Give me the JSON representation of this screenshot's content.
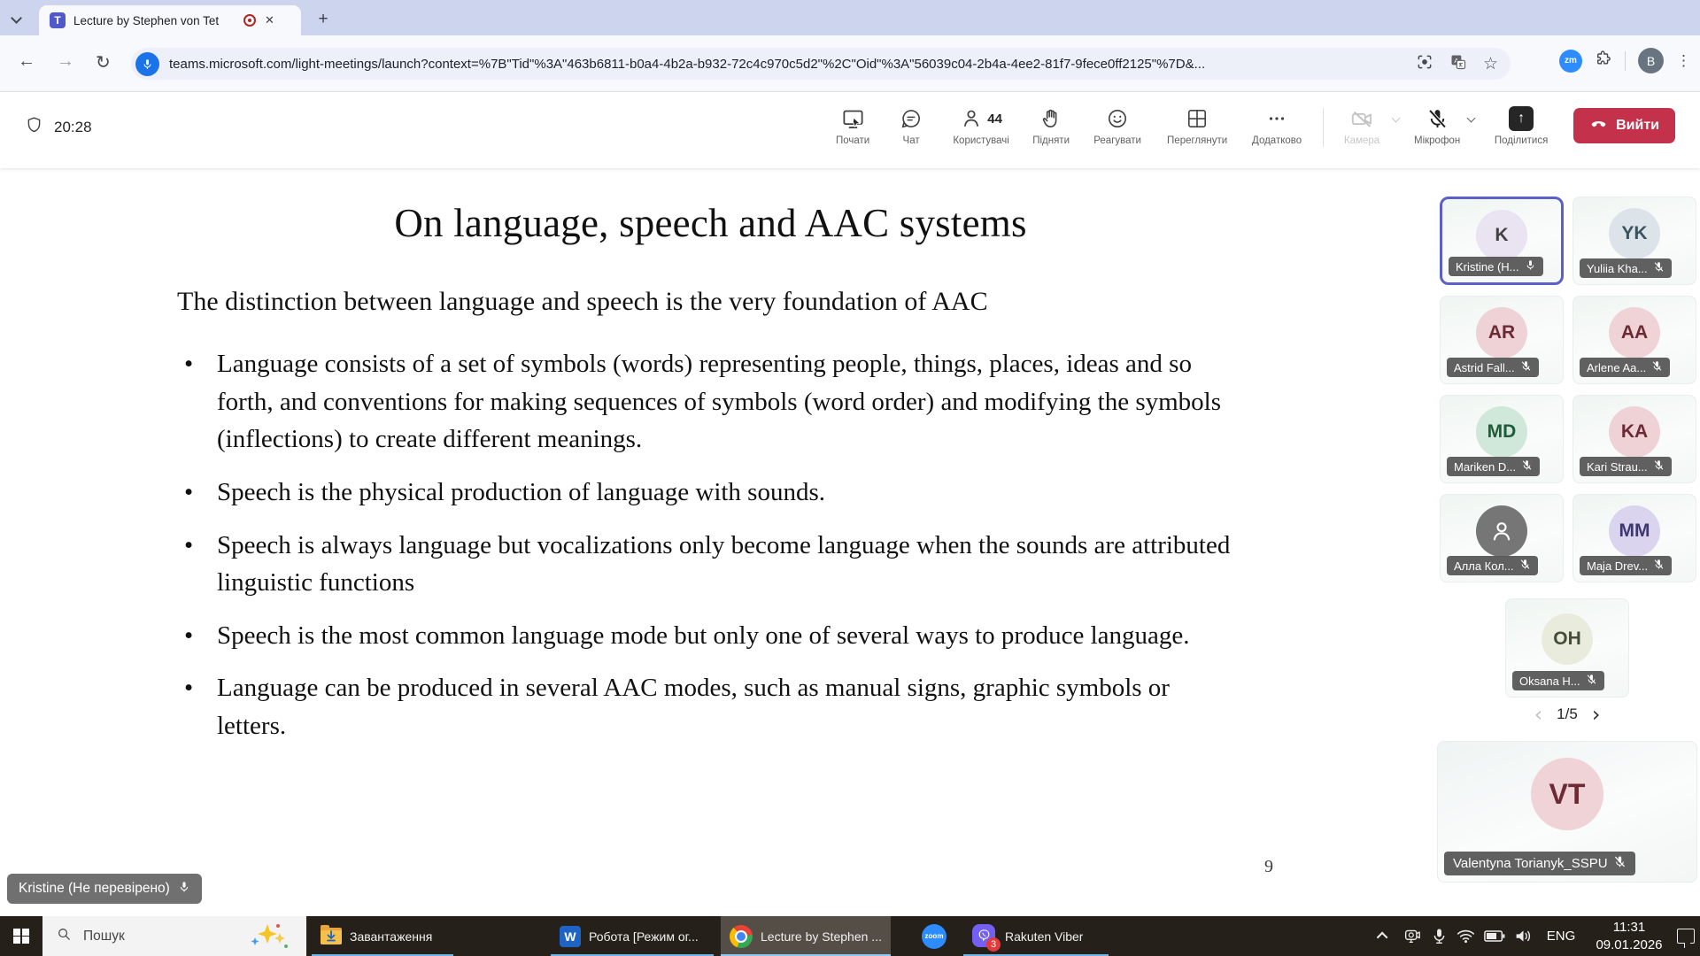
{
  "browser": {
    "tab_title": "Lecture by Stephen von Tet",
    "new_tab_label": "+",
    "url": "teams.microsoft.com/light-meetings/launch?context=%7B\"Tid\"%3A\"463b6811-b0a4-4b2a-b932-72c4c970c5d2\"%2C\"Oid\"%3A\"56039c04-2b4a-4ee2-81f7-9fece0ff2125\"%7D&...",
    "zoom_extension_label": "zm",
    "profile_initial": "B",
    "close_glyph": "✕",
    "back_glyph": "←",
    "forward_glyph": "→",
    "reload_glyph": "↻",
    "star_glyph": "☆",
    "kebab_glyph": "⋮"
  },
  "meeting": {
    "timer": "20:28",
    "controls": [
      {
        "label": "Почати"
      },
      {
        "label": "Чат"
      },
      {
        "label": "Користувачі",
        "count": "44"
      },
      {
        "label": "Підняти"
      },
      {
        "label": "Реагувати"
      },
      {
        "label": "Переглянути"
      },
      {
        "label": "Додатково"
      },
      {
        "label": "Камера",
        "disabled": true
      },
      {
        "label": "Мікрофон",
        "muted": true
      },
      {
        "label": "Поділитися",
        "share_glyph": "↑"
      }
    ],
    "leave_label": "Вийти"
  },
  "slide": {
    "title": "On language, speech and AAC systems",
    "intro": "The distinction between language and speech is the very foundation of AAC",
    "bullets": [
      "Language consists of a set of symbols (words) representing people, things, places, ideas and so forth, and conventions for making sequences of symbols (word order) and modifying the symbols (inflections) to create different meanings.",
      "Speech is the physical production of language with sounds.",
      "Speech is always language but vocalizations only become language when the sounds are attributed linguistic functions",
      "Speech is the most common language mode but only one of several ways to produce language.",
      "Language can be produced in several AAC modes, such as manual signs, graphic symbols or letters."
    ],
    "page_number": "9"
  },
  "presenter_badge": {
    "name": "Kristine (Не перевірено)",
    "muted": false
  },
  "participants": {
    "tiles": [
      {
        "initials": "K",
        "name": "Kristine (H...",
        "muted": false,
        "active": true,
        "avatar_bg": "#eae3f2",
        "avatar_fg": "#424242"
      },
      {
        "initials": "YK",
        "name": "Yuliia Kha...",
        "muted": true,
        "active": false,
        "avatar_bg": "#dde4e9",
        "avatar_fg": "#39545e"
      },
      {
        "initials": "AR",
        "name": "Astrid Fall...",
        "muted": true,
        "active": false,
        "avatar_bg": "#eed2d6",
        "avatar_fg": "#6b2a34"
      },
      {
        "initials": "AA",
        "name": "Arlene Aa...",
        "muted": true,
        "active": false,
        "avatar_bg": "#f0d3d7",
        "avatar_fg": "#6b2a34"
      },
      {
        "initials": "MD",
        "name": "Mariken D...",
        "muted": true,
        "active": false,
        "avatar_bg": "#d0e8da",
        "avatar_fg": "#1e5c3a"
      },
      {
        "initials": "KA",
        "name": "Kari Strau...",
        "muted": true,
        "active": false,
        "avatar_bg": "#eed2d6",
        "avatar_fg": "#6b2a34"
      },
      {
        "initials": "",
        "name": "Алла Кол...",
        "muted": true,
        "active": false,
        "avatar_bg": "#767676",
        "avatar_fg": "#ffffff"
      },
      {
        "initials": "MM",
        "name": "Maja Drev...",
        "muted": true,
        "active": false,
        "avatar_bg": "#dad4ee",
        "avatar_fg": "#3d3870"
      },
      {
        "initials": "OH",
        "name": "Oksana H...",
        "muted": true,
        "active": false,
        "avatar_bg": "#e9ecdd",
        "avatar_fg": "#454d39"
      }
    ],
    "pagination": {
      "current": "1/5",
      "prev_glyph": "‹",
      "next_glyph": "›"
    },
    "spotlight": {
      "initials": "VT",
      "name": "Valentyna Torianyk_SSPU",
      "muted": true,
      "avatar_bg": "#efd3d7",
      "avatar_fg": "#6b2a34"
    }
  },
  "taskbar": {
    "search_placeholder": "Пошук",
    "apps": [
      {
        "label": "Завантаження"
      },
      {
        "label": "Робота [Режим ог..."
      },
      {
        "label": "Lecture by Stephen ..."
      },
      {
        "label": "zoom"
      },
      {
        "label": "Rakuten Viber",
        "badge": "3"
      }
    ],
    "word_glyph": "W",
    "tray": {
      "language": "ENG",
      "time": "11:31",
      "date": "09.01.2026"
    }
  },
  "colors": {
    "accent_active_tile": "#5b5fc7",
    "leave_button": "#c4314b",
    "taskbar_underline": "#6fb3e8",
    "tab_strip": "#ccd4ee",
    "taskbar_bg": "#26201a"
  }
}
